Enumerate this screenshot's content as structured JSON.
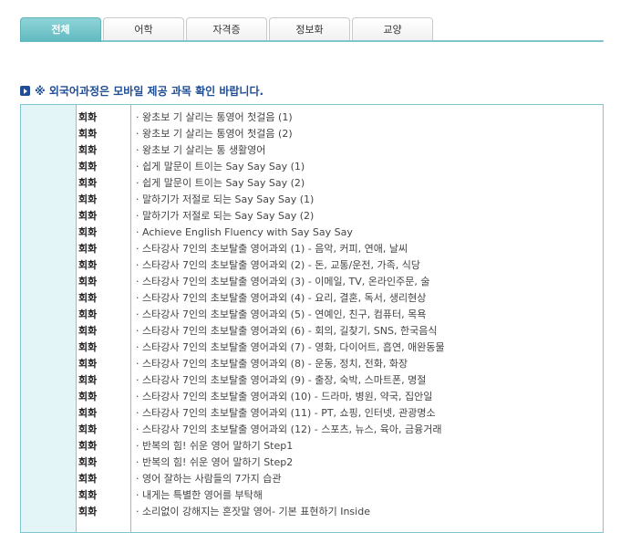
{
  "tabs": [
    "전체",
    "어학",
    "자격증",
    "정보화",
    "교양"
  ],
  "notice": "※ 외국어과정은 모바일 제공 과목 확인 바랍니다.",
  "courses": [
    {
      "category": "회화",
      "title": "· 왕초보 기 살리는 통영어 첫걸음 (1)"
    },
    {
      "category": "회화",
      "title": "· 왕초보 기 살리는 통영어 첫걸음 (2)"
    },
    {
      "category": "회화",
      "title": "· 왕초보 기 살리는 통 생활영어"
    },
    {
      "category": "회화",
      "title": "· 쉽게 말문이 트이는 Say Say Say (1)"
    },
    {
      "category": "회화",
      "title": "· 쉽게 말문이 트이는 Say Say Say (2)"
    },
    {
      "category": "회화",
      "title": "· 말하기가 저절로 되는 Say Say Say (1)"
    },
    {
      "category": "회화",
      "title": "· 말하기가 저절로 되는 Say Say Say (2)"
    },
    {
      "category": "회화",
      "title": "· Achieve English Fluency with Say Say Say"
    },
    {
      "category": "회화",
      "title": "· 스타강사 7인의 초보탈출 영어과외 (1) - 음악, 커피, 연애, 날씨"
    },
    {
      "category": "회화",
      "title": "· 스타강사 7인의 초보탈출 영어과외 (2) - 돈, 교통/운전, 가족, 식당"
    },
    {
      "category": "회화",
      "title": "· 스타강사 7인의 초보탈출 영어과외 (3) - 이메일, TV, 온라인주문, 술"
    },
    {
      "category": "회화",
      "title": "· 스타강사 7인의 초보탈출 영어과외 (4) - 요리, 결혼, 독서, 생리현상"
    },
    {
      "category": "회화",
      "title": "· 스타강사 7인의 초보탈출 영어과외 (5) - 연예인, 친구, 컴퓨터, 목욕"
    },
    {
      "category": "회화",
      "title": "· 스타강사 7인의 초보탈출 영어과외 (6) - 회의, 길찾기, SNS, 한국음식"
    },
    {
      "category": "회화",
      "title": "· 스타강사 7인의 초보탈출 영어과외 (7) - 영화, 다이어트, 흡연, 애완동물"
    },
    {
      "category": "회화",
      "title": "· 스타강사 7인의 초보탈출 영어과외 (8) - 운동, 정치, 전화, 화장"
    },
    {
      "category": "회화",
      "title": "· 스타강사 7인의 초보탈출 영어과외 (9) - 출장, 숙박, 스마트폰, 명절"
    },
    {
      "category": "회화",
      "title": "· 스타강사 7인의 초보탈출 영어과외 (10) - 드라마, 병원, 약국, 집안일"
    },
    {
      "category": "회화",
      "title": "· 스타강사 7인의 초보탈출 영어과외 (11) - PT, 쇼핑, 인터넷, 관광명소"
    },
    {
      "category": "회화",
      "title": "· 스타강사 7인의 초보탈출 영어과외 (12) - 스포츠, 뉴스, 육아, 금융거래"
    },
    {
      "category": "회화",
      "title": "· 반복의 힘! 쉬운 영어 말하기 Step1"
    },
    {
      "category": "회화",
      "title": "· 반복의 힘! 쉬운 영어 말하기 Step2"
    },
    {
      "category": "회화",
      "title": "· 영어 잘하는 사람들의 7가지 습관"
    },
    {
      "category": "회화",
      "title": "· 내게는 특별한 영어를 부탁해"
    },
    {
      "category": "회화",
      "title": "· 소리없이 강해지는 혼잣말 영어- 기본 표현하기 Inside"
    }
  ]
}
